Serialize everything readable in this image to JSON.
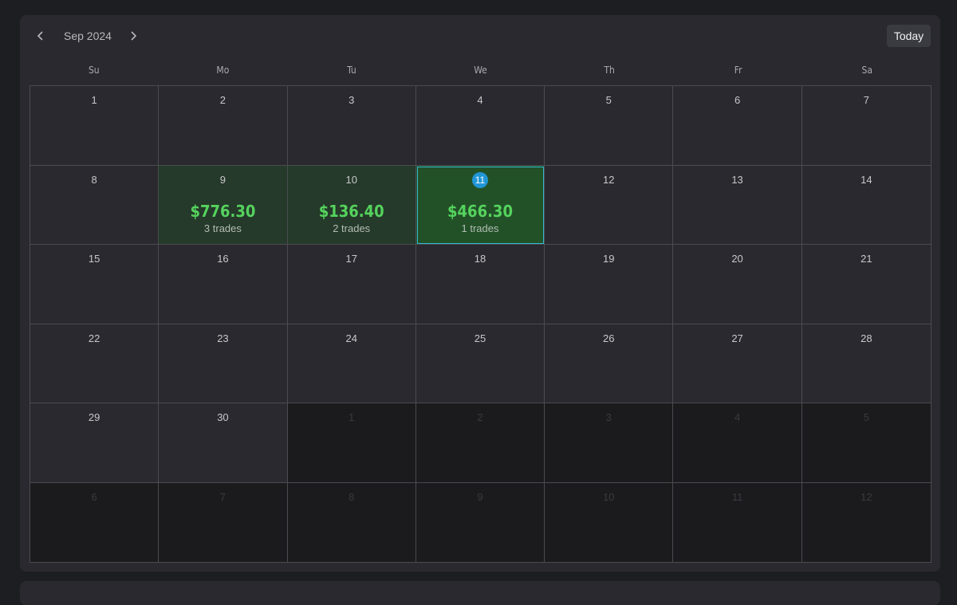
{
  "header": {
    "month_label": "Sep 2024",
    "today_label": "Today",
    "prev_icon": "chevron-left-icon",
    "next_icon": "chevron-right-icon"
  },
  "weekdays": [
    "Su",
    "Mo",
    "Tu",
    "We",
    "Th",
    "Fr",
    "Sa"
  ],
  "colors": {
    "profit_text": "#55d35d",
    "profit_cell": "#253a2a",
    "today_cell": "#225128",
    "today_badge": "#2196d6",
    "today_outline": "#33b6d0"
  },
  "days": [
    {
      "day": "1",
      "in_month": true
    },
    {
      "day": "2",
      "in_month": true
    },
    {
      "day": "3",
      "in_month": true
    },
    {
      "day": "4",
      "in_month": true
    },
    {
      "day": "5",
      "in_month": true
    },
    {
      "day": "6",
      "in_month": true
    },
    {
      "day": "7",
      "in_month": true
    },
    {
      "day": "8",
      "in_month": true
    },
    {
      "day": "9",
      "in_month": true,
      "pnl": "$776.30",
      "trades": "3 trades"
    },
    {
      "day": "10",
      "in_month": true,
      "pnl": "$136.40",
      "trades": "2 trades"
    },
    {
      "day": "11",
      "in_month": true,
      "today": true,
      "pnl": "$466.30",
      "trades": "1 trades"
    },
    {
      "day": "12",
      "in_month": true
    },
    {
      "day": "13",
      "in_month": true
    },
    {
      "day": "14",
      "in_month": true
    },
    {
      "day": "15",
      "in_month": true
    },
    {
      "day": "16",
      "in_month": true
    },
    {
      "day": "17",
      "in_month": true
    },
    {
      "day": "18",
      "in_month": true
    },
    {
      "day": "19",
      "in_month": true
    },
    {
      "day": "20",
      "in_month": true
    },
    {
      "day": "21",
      "in_month": true
    },
    {
      "day": "22",
      "in_month": true
    },
    {
      "day": "23",
      "in_month": true
    },
    {
      "day": "24",
      "in_month": true
    },
    {
      "day": "25",
      "in_month": true
    },
    {
      "day": "26",
      "in_month": true
    },
    {
      "day": "27",
      "in_month": true
    },
    {
      "day": "28",
      "in_month": true
    },
    {
      "day": "29",
      "in_month": true
    },
    {
      "day": "30",
      "in_month": true
    },
    {
      "day": "1",
      "in_month": false
    },
    {
      "day": "2",
      "in_month": false
    },
    {
      "day": "3",
      "in_month": false
    },
    {
      "day": "4",
      "in_month": false
    },
    {
      "day": "5",
      "in_month": false
    },
    {
      "day": "6",
      "in_month": false
    },
    {
      "day": "7",
      "in_month": false
    },
    {
      "day": "8",
      "in_month": false
    },
    {
      "day": "9",
      "in_month": false
    },
    {
      "day": "10",
      "in_month": false
    },
    {
      "day": "11",
      "in_month": false
    },
    {
      "day": "12",
      "in_month": false
    }
  ]
}
